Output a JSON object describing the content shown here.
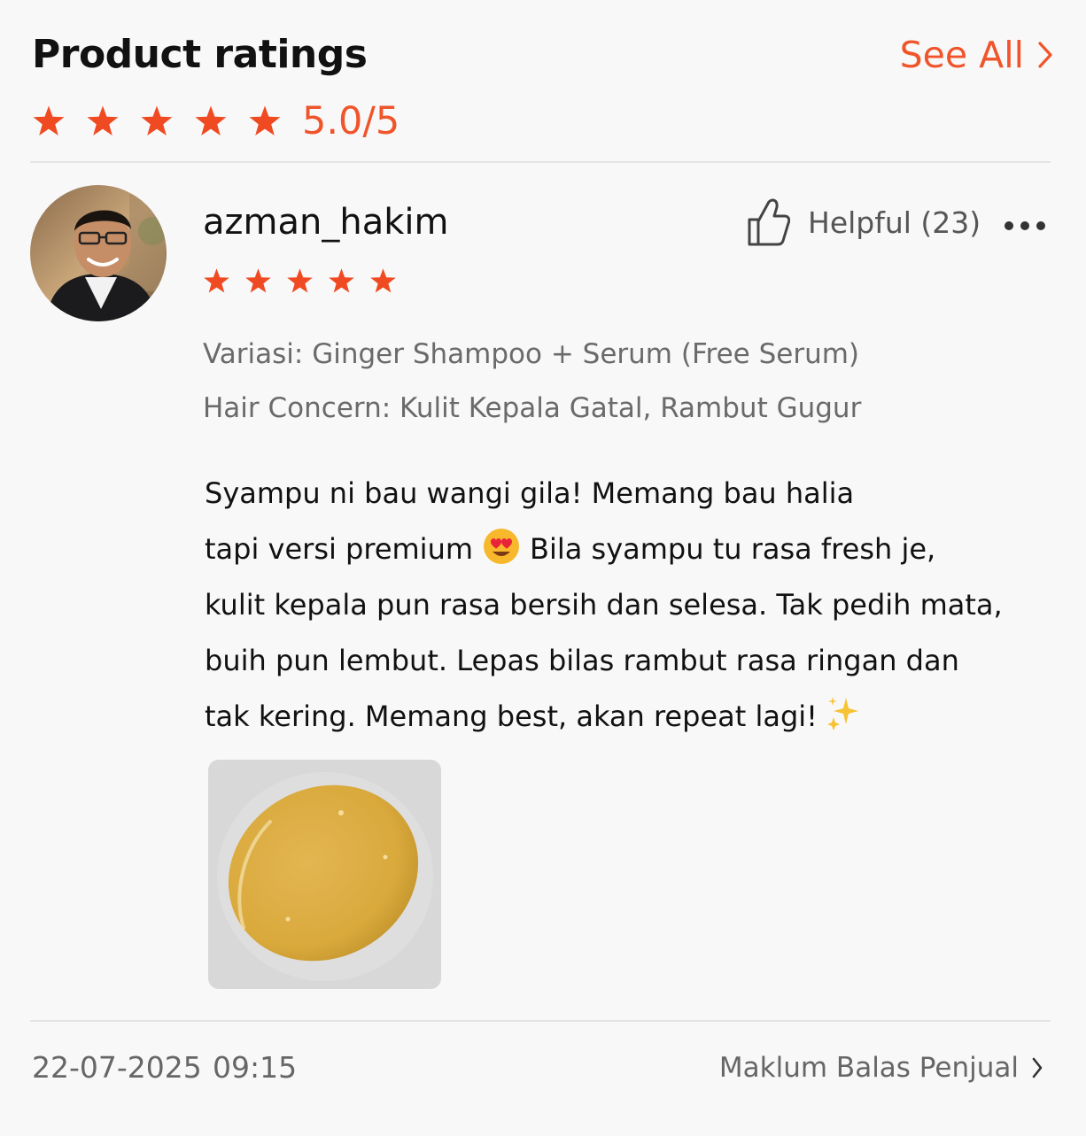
{
  "header": {
    "title": "Product ratings",
    "see_all_label": "See All",
    "score_text": "5.0/5",
    "rating_stars": 5
  },
  "review": {
    "username": "azman_hakim",
    "rating_stars": 5,
    "helpful_label": "Helpful (23)",
    "variation": "Variasi: Ginger Shampoo + Serum (Free Serum)",
    "hair_concern": "Hair Concern: Kulit Kepala Gatal, Rambut Gugur",
    "body": {
      "line1": "Syampu ni bau wangi gila! Memang bau halia",
      "line2a": "tapi versi premium",
      "line2b": "Bila syampu tu rasa fresh je,",
      "line3": "kulit kepala pun rasa bersih dan selesa. Tak pedih mata,",
      "line4": "buih pun lembut. Lepas bilas rambut rasa ringan dan",
      "line5": "tak kering. Memang best, akan repeat lagi!"
    },
    "date": "22-07-2025",
    "time": "09:15",
    "seller_reply_label": "Maklum Balas Penjual"
  },
  "colors": {
    "accent": "#f0542a",
    "star": "#f04a22",
    "text_primary": "#111111",
    "text_secondary": "#6a6a6a",
    "divider": "#e4e4e4"
  },
  "icons": {
    "star": "star-icon",
    "chevron": "chevron-right-icon",
    "thumb": "thumbs-up-icon",
    "more": "more-dots-icon",
    "emoji": "heart-eyes-emoji-icon",
    "sparkle": "sparkles-icon"
  }
}
